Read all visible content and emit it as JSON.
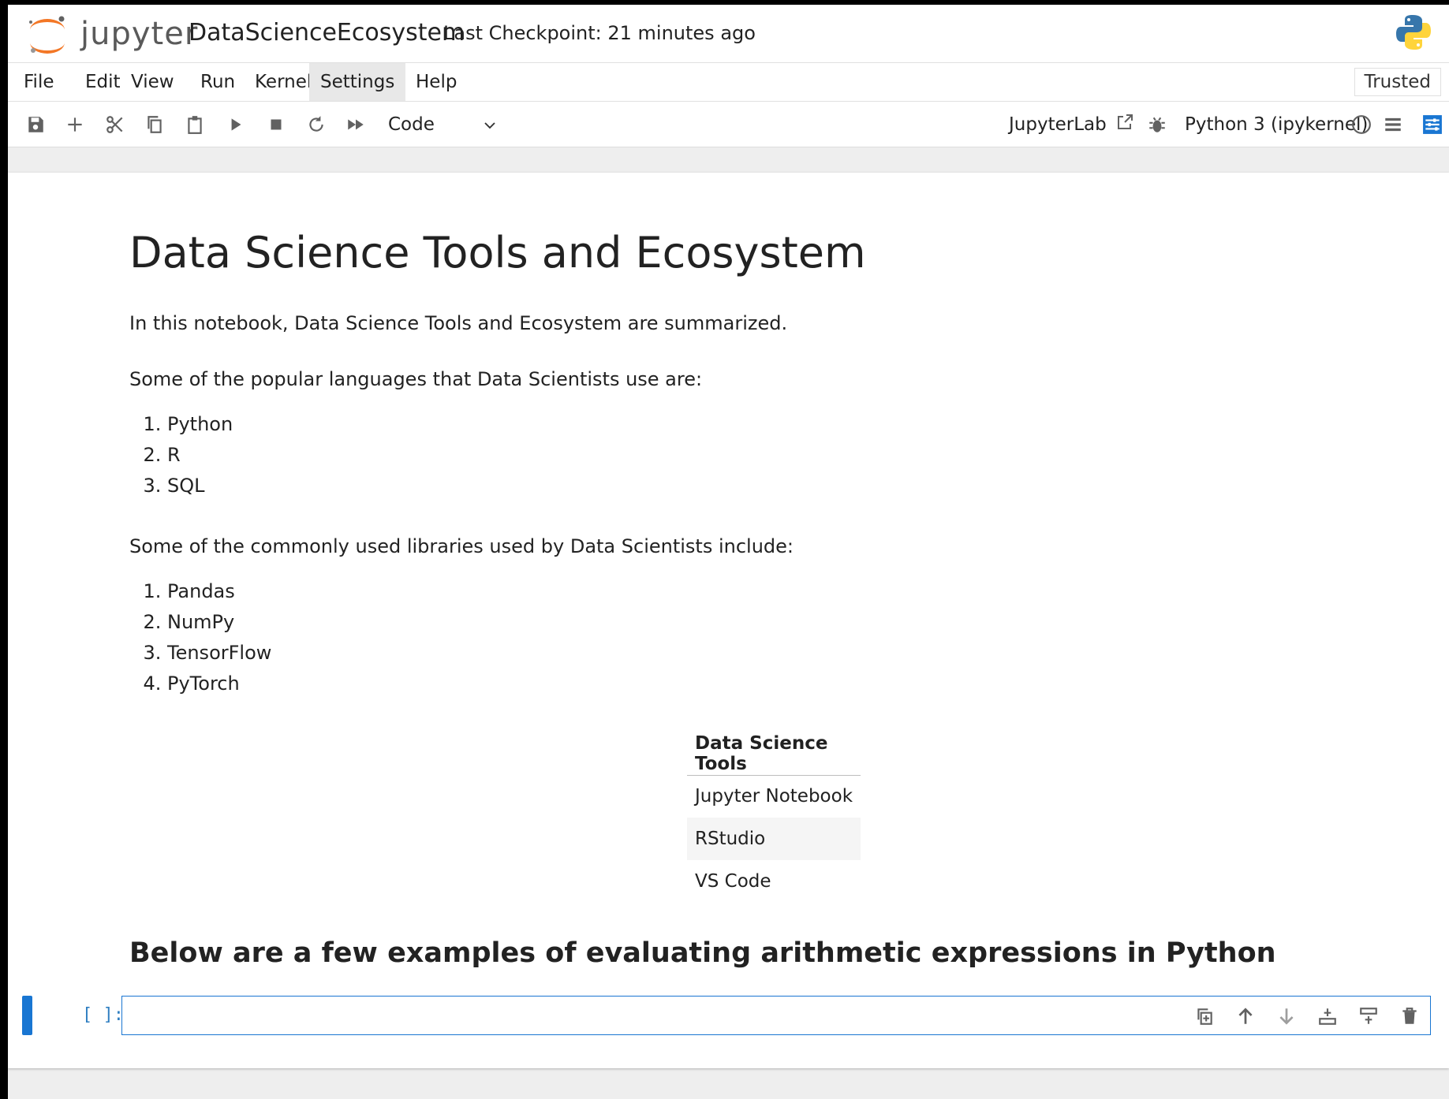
{
  "header": {
    "logo_text": "jupyter",
    "notebook_title": "DataScienceEcosystem",
    "checkpoint": "Last Checkpoint: 21 minutes ago"
  },
  "menu": {
    "items": [
      "File",
      "Edit",
      "View",
      "Run",
      "Kernel",
      "Settings",
      "Help"
    ],
    "trusted": "Trusted"
  },
  "toolbar": {
    "cell_type": "Code",
    "jupyterlab_label": "JupyterLab",
    "kernel_name": "Python 3 (ipykernel)",
    "icons": [
      "save-icon",
      "plus-icon",
      "scissors-icon",
      "copy-icon",
      "paste-icon",
      "run-icon",
      "stop-icon",
      "restart-icon",
      "fast-forward-icon"
    ]
  },
  "notebook": {
    "title": "Data Science Tools and Ecosystem",
    "intro": "In this notebook, Data Science Tools and Ecosystem are summarized.",
    "languages_intro": "Some of the popular languages that Data Scientists use are:",
    "languages": [
      "Python",
      "R",
      "SQL"
    ],
    "libraries_intro": "Some of the commonly used libraries used by Data Scientists include:",
    "libraries": [
      "Pandas",
      "NumPy",
      "TensorFlow",
      "PyTorch"
    ],
    "tools_table": {
      "header": "Data Science Tools",
      "rows": [
        "Jupyter Notebook",
        "RStudio",
        "VS Code"
      ]
    },
    "arith_heading": "Below are a few examples of evaluating arithmetic expressions in Python",
    "code_prompt": "[ ]:"
  },
  "colors": {
    "accent": "#1976d2",
    "prompt": "#307fc1",
    "jupyter_orange": "#f37726"
  }
}
